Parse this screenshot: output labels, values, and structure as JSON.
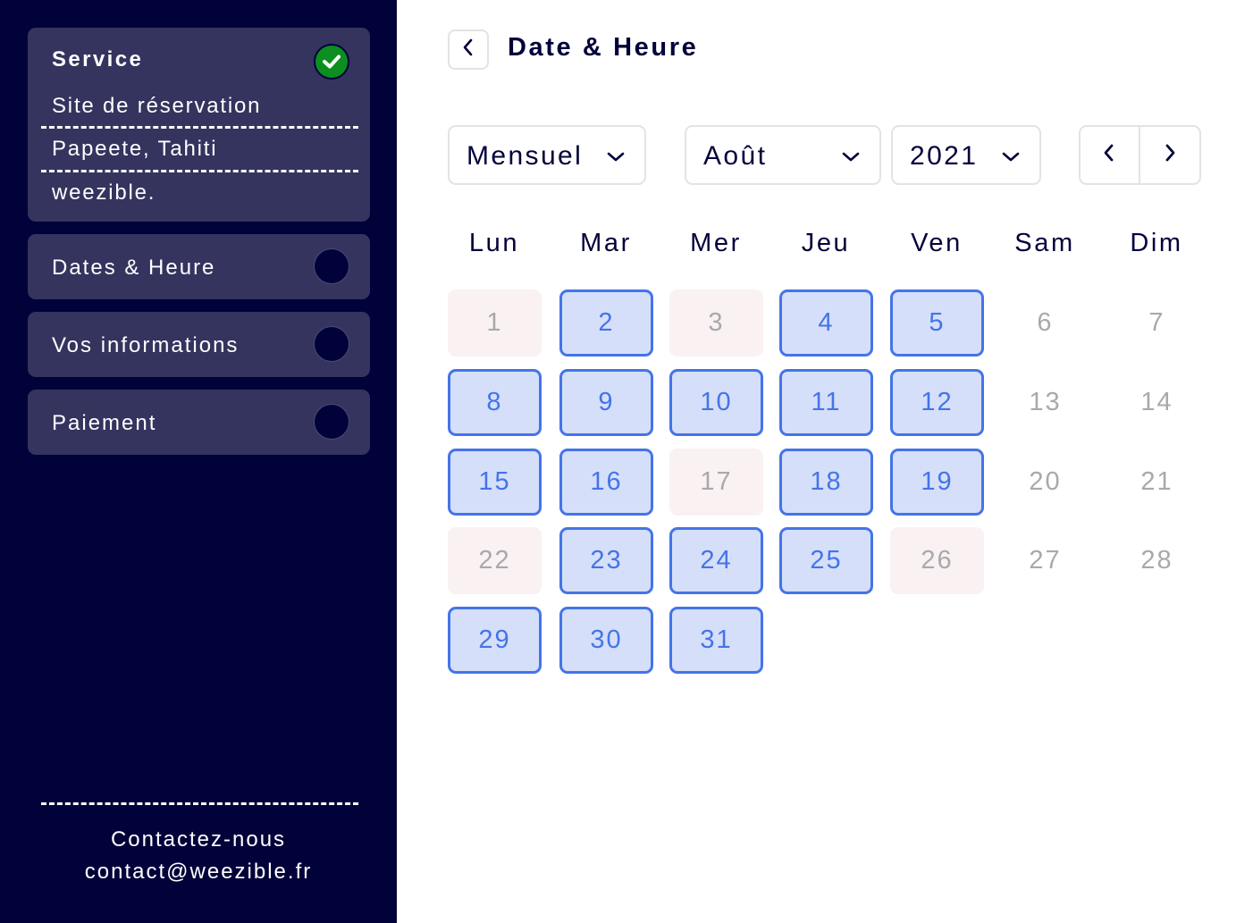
{
  "sidebar": {
    "steps": [
      {
        "title": "Service",
        "status": "completed",
        "status_icon": "check-circle-icon",
        "details": [
          "Site de réservation",
          "Papeete, Tahiti",
          "weezible."
        ]
      },
      {
        "title": "Dates & Heure",
        "status": "pending",
        "status_icon": "empty-circle-icon"
      },
      {
        "title": "Vos informations",
        "status": "pending",
        "status_icon": "empty-circle-icon"
      },
      {
        "title": "Paiement",
        "status": "pending",
        "status_icon": "empty-circle-icon"
      }
    ],
    "footer": {
      "contact_label": "Contactez-nous",
      "contact_email": "contact@weezible.fr"
    }
  },
  "header": {
    "back_icon": "chevron-left-icon",
    "title": "Date & Heure"
  },
  "controls": {
    "view_mode": "Mensuel",
    "month": "Août",
    "year": "2021",
    "prev_icon": "chevron-left-icon",
    "next_icon": "chevron-right-icon"
  },
  "calendar": {
    "weekdays": [
      "Lun",
      "Mar",
      "Mer",
      "Jeu",
      "Ven",
      "Sam",
      "Dim"
    ],
    "days": [
      {
        "day": "1",
        "state": "unavailable"
      },
      {
        "day": "2",
        "state": "available"
      },
      {
        "day": "3",
        "state": "unavailable"
      },
      {
        "day": "4",
        "state": "available"
      },
      {
        "day": "5",
        "state": "available"
      },
      {
        "day": "6",
        "state": "weekend"
      },
      {
        "day": "7",
        "state": "weekend"
      },
      {
        "day": "8",
        "state": "available"
      },
      {
        "day": "9",
        "state": "available"
      },
      {
        "day": "10",
        "state": "available"
      },
      {
        "day": "11",
        "state": "available"
      },
      {
        "day": "12",
        "state": "available"
      },
      {
        "day": "13",
        "state": "weekend"
      },
      {
        "day": "14",
        "state": "weekend"
      },
      {
        "day": "15",
        "state": "available"
      },
      {
        "day": "16",
        "state": "available"
      },
      {
        "day": "17",
        "state": "unavailable"
      },
      {
        "day": "18",
        "state": "available"
      },
      {
        "day": "19",
        "state": "available"
      },
      {
        "day": "20",
        "state": "weekend"
      },
      {
        "day": "21",
        "state": "weekend"
      },
      {
        "day": "22",
        "state": "unavailable"
      },
      {
        "day": "23",
        "state": "available"
      },
      {
        "day": "24",
        "state": "available"
      },
      {
        "day": "25",
        "state": "available"
      },
      {
        "day": "26",
        "state": "unavailable"
      },
      {
        "day": "27",
        "state": "weekend"
      },
      {
        "day": "28",
        "state": "weekend"
      },
      {
        "day": "29",
        "state": "available"
      },
      {
        "day": "30",
        "state": "available"
      },
      {
        "day": "31",
        "state": "available"
      }
    ]
  },
  "colors": {
    "sidebar_bg": "#02023a",
    "step_bg": "#34345f",
    "completed": "#0c8e20",
    "available_bg": "#d5dff9",
    "available_border": "#4474e8",
    "unavailable_bg": "#f9f1f2",
    "muted_text": "#a8a9ad"
  }
}
